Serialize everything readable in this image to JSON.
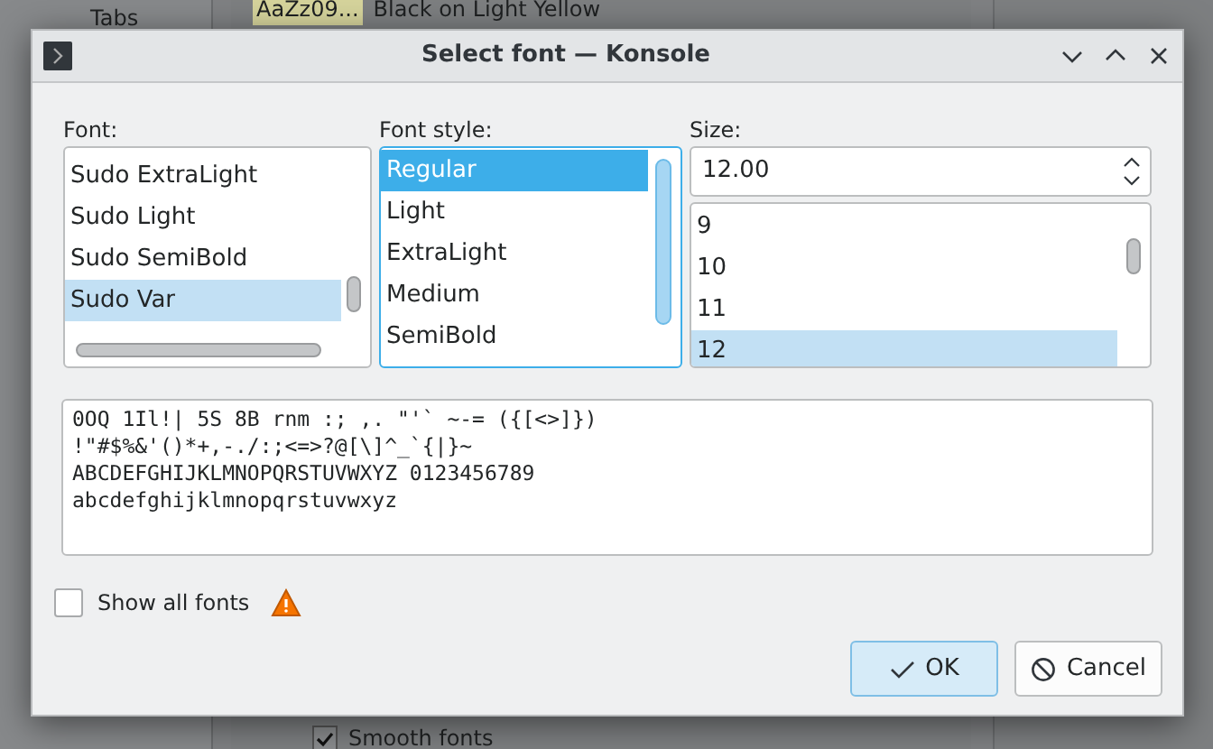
{
  "background_window": {
    "sidebar_items": [
      {
        "label": "Tabs"
      }
    ],
    "scheme_row": {
      "sample": "AaZz09...",
      "name": "Black on Light Yellow"
    },
    "smooth_fonts": {
      "label": "Smooth fonts",
      "checked": true
    }
  },
  "dialog": {
    "title": "Select font — Konsole",
    "font": {
      "label": "Font:",
      "items": [
        {
          "label": "Sudo ExtraLight",
          "selected": false
        },
        {
          "label": "Sudo Light",
          "selected": false
        },
        {
          "label": "Sudo SemiBold",
          "selected": false
        },
        {
          "label": "Sudo Var",
          "selected": true
        }
      ]
    },
    "font_style": {
      "label": "Font style:",
      "items": [
        {
          "label": "Regular",
          "selected": true
        },
        {
          "label": "Light",
          "selected": false
        },
        {
          "label": "ExtraLight",
          "selected": false
        },
        {
          "label": "Medium",
          "selected": false
        },
        {
          "label": "SemiBold",
          "selected": false
        }
      ]
    },
    "size": {
      "label": "Size:",
      "value": "12.00",
      "items": [
        {
          "label": "9",
          "selected": false
        },
        {
          "label": "10",
          "selected": false
        },
        {
          "label": "11",
          "selected": false
        },
        {
          "label": "12",
          "selected": true
        }
      ]
    },
    "preview": [
      "0OQ 1Il!| 5S 8B rnm :; ,. \"'` ~-= ({[<>]})",
      "!\"#$%&'()*+,-./:;<=>?@[\\]^_`{|}~",
      "ABCDEFGHIJKLMNOPQRSTUVWXYZ 0123456789",
      "abcdefghijklmnopqrstuvwxyz"
    ],
    "show_all_fonts": {
      "label": "Show all fonts",
      "checked": false
    },
    "buttons": [
      {
        "kind": "ok",
        "label": "OK"
      },
      {
        "kind": "cancel",
        "label": "Cancel"
      }
    ]
  }
}
